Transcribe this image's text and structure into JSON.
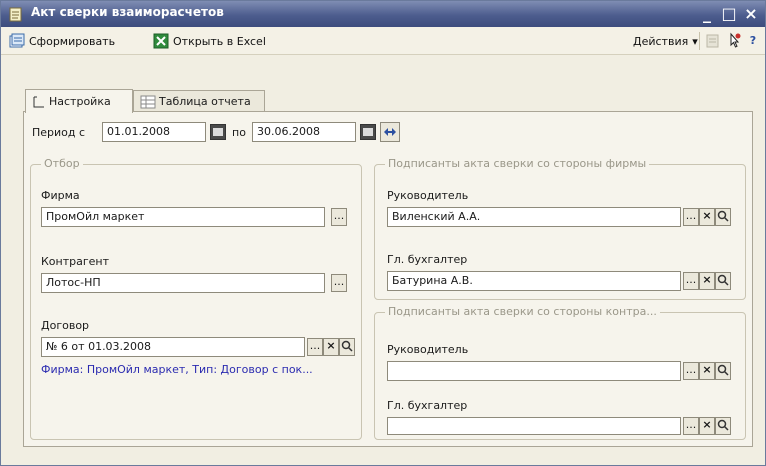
{
  "window": {
    "title": "Акт сверки взаиморасчетов",
    "min_glyph": "_",
    "max_glyph": "□",
    "close_glyph": "×"
  },
  "toolbar": {
    "form_label": "Сформировать",
    "excel_label": "Открыть в Excel",
    "actions_label": "Действия",
    "actions_arrow": "▾",
    "help_glyph": "?"
  },
  "tabs": [
    {
      "label": "Настройка",
      "icon": "settings-icon",
      "active": true
    },
    {
      "label": "Таблица отчета",
      "icon": "table-icon",
      "active": false
    }
  ],
  "period": {
    "label_from": "Период с",
    "date_from": "01.01.2008",
    "label_to": "по",
    "date_to": "30.06.2008"
  },
  "selection_group": {
    "title": "Отбор",
    "firm_label": "Фирма",
    "firm_value": "ПромОйл маркет",
    "counterparty_label": "Контрагент",
    "counterparty_value": "Лотос-НП",
    "contract_label": "Договор",
    "contract_value": "№ 6 от 01.03.2008",
    "contract_info": "Фирма: ПромОйл маркет, Тип: Договор с пок..."
  },
  "firm_signers": {
    "title": "Подписанты акта сверки со стороны фирмы",
    "head_label": "Руководитель",
    "head_value": "Виленский А.А.",
    "accountant_label": "Гл. бухгалтер",
    "accountant_value": "Батурина А.В."
  },
  "counterparty_signers": {
    "title": "Подписанты акта сверки со стороны контра...",
    "head_label": "Руководитель",
    "head_value": "",
    "accountant_label": "Гл. бухгалтер",
    "accountant_value": ""
  },
  "buttons": {
    "select_glyph": "...",
    "clear_glyph": "×",
    "open_glyph": "🔍"
  },
  "colors": {
    "title_bar": "#4d5d8e",
    "link": "#2b2bb0",
    "group_title": "#9a9789"
  }
}
